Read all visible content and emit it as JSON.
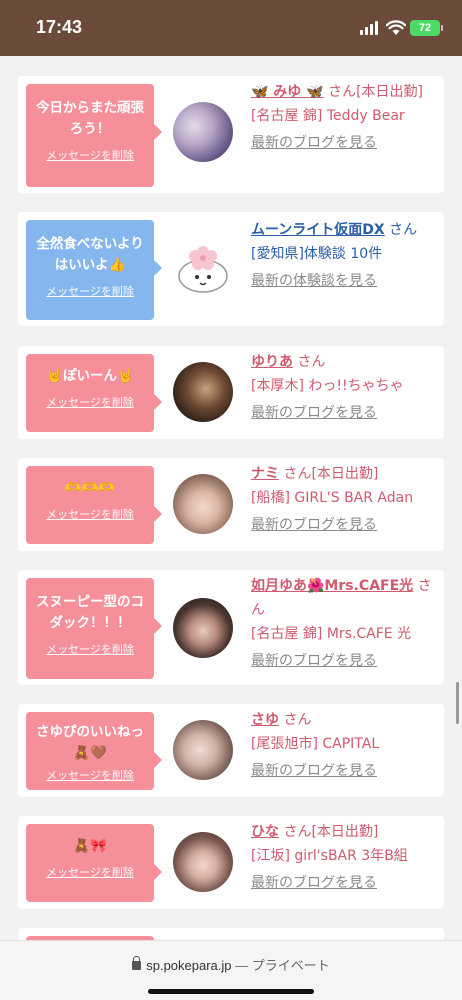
{
  "status": {
    "time": "17:43",
    "battery": "72"
  },
  "colors": {
    "pink": "#f5909a",
    "blue": "#86b6ee",
    "name_pink": "#d05a6e",
    "name_blue": "#2a5fa8",
    "statusbar": "#6b4a3a"
  },
  "cards": [
    {
      "bubble_color": "pink",
      "message": "今日からまた頑張ろう！",
      "delete_label": "メッセージを削除",
      "name": "🦋 みゆ 🦋",
      "suffix": "さん[本日出勤]",
      "shop": "[名古屋 錦] Teddy Bear",
      "link": "最新のブログを見る"
    },
    {
      "bubble_color": "blue",
      "message": "全然食べないよりはいいよ👍",
      "delete_label": "メッセージを削除",
      "name": "ムーンライト仮面DX",
      "suffix": "さん",
      "shop": "[愛知県]体験談 10件",
      "link": "最新の体験談を見る"
    },
    {
      "bubble_color": "pink",
      "message": "🤘ぽいーん🤘",
      "delete_label": "メッセージを削除",
      "name": "ゆりあ",
      "suffix": "さん",
      "shop": "[本厚木] わっ!!ちゃちゃ",
      "link": "最新のブログを見る"
    },
    {
      "bubble_color": "pink",
      "message": "🫶🫶🫶",
      "delete_label": "メッセージを削除",
      "name": "ナミ",
      "suffix": "さん[本日出勤]",
      "shop": "[船橋] GIRL'S BAR Adan",
      "link": "最新のブログを見る"
    },
    {
      "bubble_color": "pink",
      "message": "スヌーピー型のコダック！！！",
      "delete_label": "メッセージを削除",
      "name": "如月ゆあ🌺Mrs.CAFE光",
      "suffix": "さん",
      "shop": "[名古屋 錦] Mrs.CAFE 光",
      "link": "最新のブログを見る"
    },
    {
      "bubble_color": "pink",
      "message": "さゆぴのいいねっ🧸🤎",
      "delete_label": "メッセージを削除",
      "name": "さゆ",
      "suffix": "さん",
      "shop": "[尾張旭市] CAPITAL",
      "link": "最新のブログを見る"
    },
    {
      "bubble_color": "pink",
      "message": "🧸🎀",
      "delete_label": "メッセージを削除",
      "name": "ひな",
      "suffix": "さん[本日出勤]",
      "shop": "[江坂] girl'sBAR 3年B組",
      "link": "最新のブログを見る"
    }
  ],
  "url_bar": {
    "domain": "sp.pokepara.jp",
    "label": "— プライベート"
  }
}
